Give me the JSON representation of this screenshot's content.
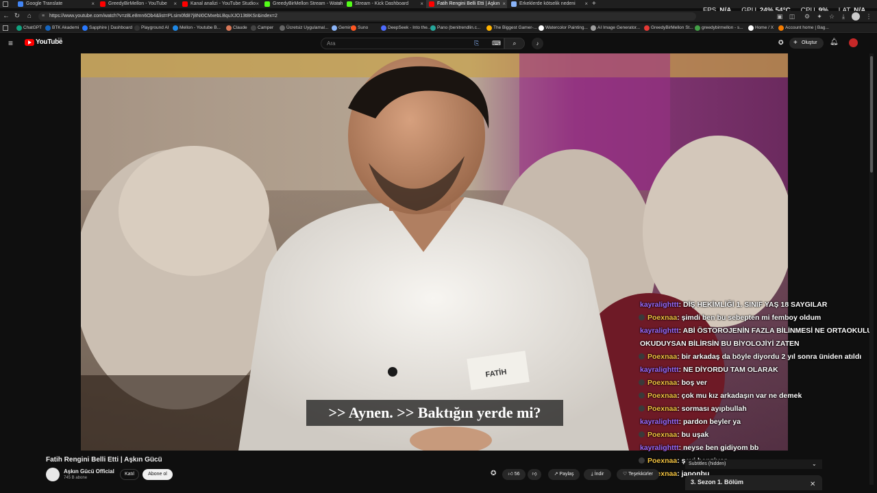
{
  "tabs": [
    {
      "title": "Google Translate",
      "color": "#4285f4"
    },
    {
      "title": "GreedyBirMellon - YouTube",
      "color": "#ff0000"
    },
    {
      "title": "Kanal analizi - YouTube Studio",
      "color": "#ff0000"
    },
    {
      "title": "GreedyBirMellon Stream - Watch",
      "color": "#53fc18"
    },
    {
      "title": "Stream - Kick Dashboard",
      "color": "#53fc18"
    },
    {
      "title": "Fatih Rengini Belli Etti | Aşkın",
      "color": "#ff0000"
    },
    {
      "title": "Erkeklerde kötselik nedeni",
      "color": "#8ab4f8"
    }
  ],
  "hud": {
    "fps_label": "FPS",
    "fps_value": "N/A",
    "gpu_label": "GPU",
    "gpu_value": "24% 54°C",
    "cpu_label": "CPU",
    "cpu_value": "9%",
    "lat_label": "LAT",
    "lat_value": "N/A"
  },
  "browser": {
    "url": "https://www.youtube.com/watch?v=z8Le8mn6Ob4&list=PLsim0fd87j8NI0CMxebLBquXJO13t8KSr&index=2"
  },
  "bookmarks": [
    {
      "label": "ChatGPT",
      "color": "#10a37f"
    },
    {
      "label": "BTK Akademi",
      "color": "#1565c0"
    },
    {
      "label": "Sapphire | Dashboard",
      "color": "#2979ff"
    },
    {
      "label": "Playground AI",
      "color": "#333333"
    },
    {
      "label": "Mellon - Youtube B...",
      "color": "#1e88e5"
    },
    {
      "label": "Claude",
      "color": "#d97757"
    },
    {
      "label": "Camper",
      "color": "#444444"
    },
    {
      "label": "Ücretsiz Uygulamal...",
      "color": "#666666"
    },
    {
      "label": "Gemini",
      "color": "#8ab4f8"
    },
    {
      "label": "Suno",
      "color": "#ff5722"
    },
    {
      "label": "DeepSeek - Into the...",
      "color": "#4d6bfe"
    },
    {
      "label": "Pano (benitrendlin.c...",
      "color": "#26a69a"
    },
    {
      "label": "The Biggest Gamer-...",
      "color": "#ffb300"
    },
    {
      "label": "Watercolor Painting...",
      "color": "#ffffff"
    },
    {
      "label": "AI Image Generator...",
      "color": "#9e9e9e"
    },
    {
      "label": "GreedyBirMellon St...",
      "color": "#e53935"
    },
    {
      "label": "greedybirmellon - s...",
      "color": "#43a047"
    },
    {
      "label": "Home / X",
      "color": "#ffffff"
    },
    {
      "label": "Account home | Bag...",
      "color": "#f57c00"
    }
  ],
  "youtube": {
    "logo": "YouTube",
    "country": "TR",
    "search_placeholder": "Ara",
    "create_label": "Oluştur"
  },
  "video": {
    "caption": ">> Aynen. >> Baktığın yerde mi?",
    "name_tag": "FATİH"
  },
  "chat": [
    {
      "user": "kayralighttt",
      "color": "#9b6bff",
      "badge": false,
      "message": ": DİŞ HEKİMLİĞİ 1. SINIF YAŞ 18 SAYGILAR"
    },
    {
      "user": "Poexnaa",
      "color": "#f5c542",
      "badge": true,
      "message": ": şimdi ben bu sebepten mi femboy oldum"
    },
    {
      "user": "kayralighttt",
      "color": "#9b6bff",
      "badge": false,
      "message": ": ABİ ÖSTOROJENİN FAZLA BİLİNMESİ NE ORTAOKULU OKUDUYSAN BİLİRSİN BU BİYOLOJİYİ ZATEN"
    },
    {
      "user": "Poexnaa",
      "color": "#f5c542",
      "badge": true,
      "message": ": bir arkadaş da böyle diyordu 2 yıl sonra üniden atıldı"
    },
    {
      "user": "kayralighttt",
      "color": "#9b6bff",
      "badge": false,
      "message": ": NE DİYORDU TAM OLARAK"
    },
    {
      "user": "Poexnaa",
      "color": "#f5c542",
      "badge": true,
      "message": ": boş ver"
    },
    {
      "user": "Poexnaa",
      "color": "#f5c542",
      "badge": true,
      "message": ": çok mu kız arkadaşın var ne demek"
    },
    {
      "user": "Poexnaa",
      "color": "#f5c542",
      "badge": true,
      "message": ": sorması ayıpbullah"
    },
    {
      "user": "kayralighttt",
      "color": "#9b6bff",
      "badge": false,
      "message": ": pardon beyler ya"
    },
    {
      "user": "Poexnaa",
      "color": "#f5c542",
      "badge": true,
      "message": ": bu uşak"
    },
    {
      "user": "kayralighttt",
      "color": "#9b6bff",
      "badge": false,
      "message": ": neyse ben gidiyom bb"
    },
    {
      "user": "Poexnaa",
      "color": "#f5c542",
      "badge": true,
      "message": ": şeyi benziyor"
    },
    {
      "user": "Poexnaa",
      "color": "#f5c542",
      "badge": true,
      "message": ": japonbu"
    }
  ],
  "below": {
    "title": "Fatih Rengini Belli Etti | Aşkın Gücü",
    "channel_name": "Aşkın Gücü Official",
    "channel_subs": "745 B abone",
    "join": "Katıl",
    "subscribe": "Abone ol",
    "likes": "56",
    "share": "Paylaş",
    "download": "İndir",
    "thanks": "Teşekkürler"
  },
  "side": {
    "subtitles": "Subtitles (hidden)",
    "playlist_item": "3. Sezon 1. Bölüm"
  }
}
